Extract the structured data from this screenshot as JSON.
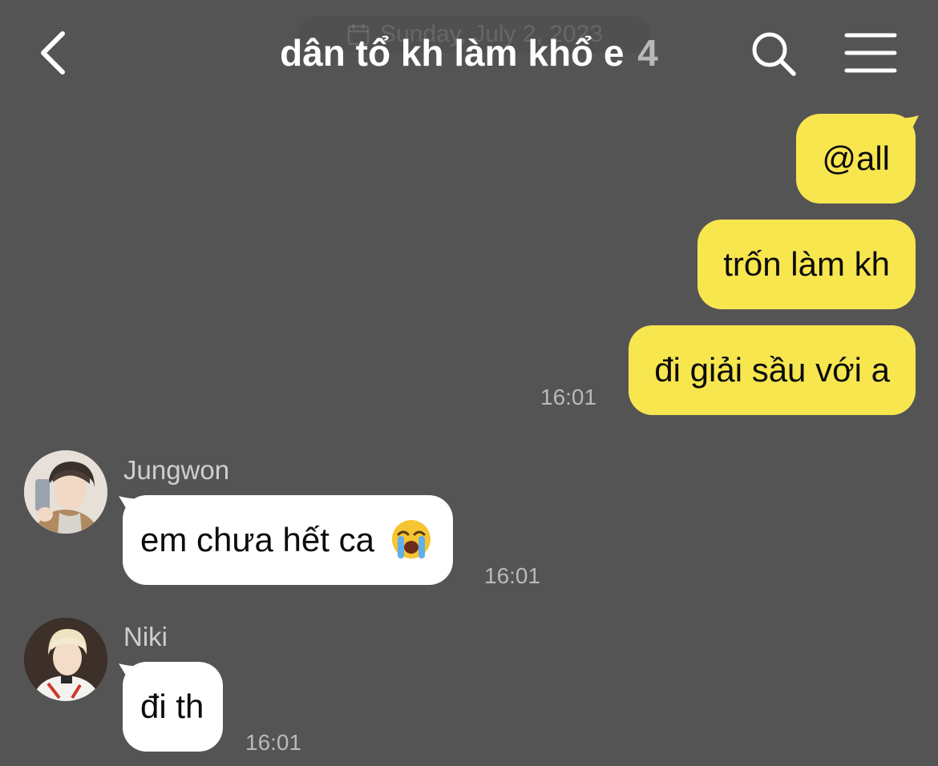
{
  "header": {
    "date_label": "Sunday, July 2, 2023",
    "title": "dân tổ kh làm khổ e",
    "member_count": "4",
    "back_icon": "chevron-left-icon",
    "search_icon": "search-icon",
    "menu_icon": "hamburger-menu-icon"
  },
  "messages": {
    "outgoing": [
      {
        "text": "@all"
      },
      {
        "text": "trốn làm kh"
      },
      {
        "text": "đi giải sầu với a",
        "time": "16:01"
      }
    ],
    "jungwon": {
      "name": "Jungwon",
      "text": "em chưa hết ca",
      "emoji": "loudly-crying-face-icon",
      "time": "16:01"
    },
    "niki": {
      "name": "Niki",
      "text": "đi th",
      "time": "16:01"
    }
  },
  "colors": {
    "background": "#555455",
    "outgoing_bubble": "#f8e64f",
    "incoming_bubble": "#ffffff",
    "timestamp": "#bab9ba"
  }
}
